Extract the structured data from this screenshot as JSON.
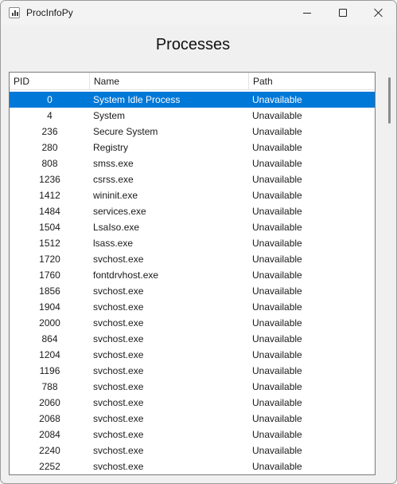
{
  "window": {
    "title": "ProcInfoPy",
    "controls": [
      "minimize",
      "maximize",
      "close"
    ]
  },
  "heading": "Processes",
  "table": {
    "columns": [
      "PID",
      "Name",
      "Path"
    ],
    "selected_row": 0,
    "rows": [
      {
        "pid": "0",
        "name": "System Idle Process",
        "path": "Unavailable"
      },
      {
        "pid": "4",
        "name": "System",
        "path": "Unavailable"
      },
      {
        "pid": "236",
        "name": "Secure System",
        "path": "Unavailable"
      },
      {
        "pid": "280",
        "name": "Registry",
        "path": "Unavailable"
      },
      {
        "pid": "808",
        "name": "smss.exe",
        "path": "Unavailable"
      },
      {
        "pid": "1236",
        "name": "csrss.exe",
        "path": "Unavailable"
      },
      {
        "pid": "1412",
        "name": "wininit.exe",
        "path": "Unavailable"
      },
      {
        "pid": "1484",
        "name": "services.exe",
        "path": "Unavailable"
      },
      {
        "pid": "1504",
        "name": "LsaIso.exe",
        "path": "Unavailable"
      },
      {
        "pid": "1512",
        "name": "lsass.exe",
        "path": "Unavailable"
      },
      {
        "pid": "1720",
        "name": "svchost.exe",
        "path": "Unavailable"
      },
      {
        "pid": "1760",
        "name": "fontdrvhost.exe",
        "path": "Unavailable"
      },
      {
        "pid": "1856",
        "name": "svchost.exe",
        "path": "Unavailable"
      },
      {
        "pid": "1904",
        "name": "svchost.exe",
        "path": "Unavailable"
      },
      {
        "pid": "2000",
        "name": "svchost.exe",
        "path": "Unavailable"
      },
      {
        "pid": "864",
        "name": "svchost.exe",
        "path": "Unavailable"
      },
      {
        "pid": "1204",
        "name": "svchost.exe",
        "path": "Unavailable"
      },
      {
        "pid": "1196",
        "name": "svchost.exe",
        "path": "Unavailable"
      },
      {
        "pid": "788",
        "name": "svchost.exe",
        "path": "Unavailable"
      },
      {
        "pid": "2060",
        "name": "svchost.exe",
        "path": "Unavailable"
      },
      {
        "pid": "2068",
        "name": "svchost.exe",
        "path": "Unavailable"
      },
      {
        "pid": "2084",
        "name": "svchost.exe",
        "path": "Unavailable"
      },
      {
        "pid": "2240",
        "name": "svchost.exe",
        "path": "Unavailable"
      },
      {
        "pid": "2252",
        "name": "svchost.exe",
        "path": "Unavailable"
      }
    ]
  },
  "colors": {
    "selection": "#0078d7",
    "selection_text": "#ffffff",
    "window_bg": "#f0f0f0",
    "table_bg": "#ffffff"
  },
  "icons": {
    "app": "chart-app-icon",
    "minimize": "minimize-icon",
    "maximize": "maximize-icon",
    "close": "close-icon"
  }
}
